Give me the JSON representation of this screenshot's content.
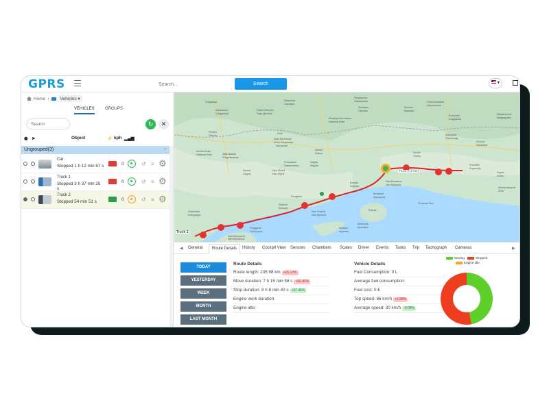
{
  "app": {
    "logo": "GPRS",
    "search_placeholder": "Search...",
    "search_button": "Search"
  },
  "breadcrumb": {
    "home": "Home",
    "vehicles": "Vehicles"
  },
  "left_tabs": {
    "vehicles": "VEHICLES",
    "groups": "GROUPS"
  },
  "left_search_placeholder": "Search",
  "table_head": {
    "object": "Object",
    "kph": "kph"
  },
  "group": {
    "label": "Ungrouped(3)",
    "collapse": "−"
  },
  "vehicles": [
    {
      "name": "Car",
      "status": "Stopped 1 h 12 min 57 s",
      "speed": "0",
      "engine_color": "#e53935",
      "signal_color": "#2eb85c"
    },
    {
      "name": "Truck 1",
      "status": "Stopped 3 h 37 min 25",
      "status2": "s",
      "speed": "0",
      "engine_color": "#e53935",
      "signal_color": "#2eb85c"
    },
    {
      "name": "Truck 2",
      "status": "Stopped 54 min 51 s",
      "speed": "0",
      "engine_color": "#2e9e44",
      "signal_color": "#f39c34"
    }
  ],
  "map": {
    "labels": [
      "Струмица",
      "Sandanski",
      "Сандански",
      "Gotse Delchev",
      "Гоце Делчев",
      "Satovcha",
      "Сатовча",
      "Pamporovo",
      "Пампорово",
      "Smolyan",
      "Смолян",
      "Rhodopi Mountains",
      "National Park",
      "Kirkovo",
      "Кирково",
      "Chernoochene",
      "Черноочене",
      "Kardzhali",
      "Кърджали",
      "Madzharovo",
      "Маджарово",
      "Petrich",
      "Петрич",
      "Kato Nevrokopi",
      "Κάτω Νευροκόπι",
      "Kerkini Lake",
      "National Park",
      "Sidirokastro",
      "Σιδηρόκαστρο",
      "Kato",
      "Nevrokopi",
      "Δράμα",
      "Drama",
      "Prosotsani",
      "Προσοτσάνη",
      "Xanthi",
      "Ξάνθη",
      "Komotini",
      "Κομοτηνή",
      "Sapes",
      "Σάπες",
      "Alexandroupoli",
      "Σπίτι",
      "Serres",
      "Σέρρες",
      "Nea Zichni",
      "Νέα Ζίχνη",
      "Nigrita",
      "Νιγρίτα",
      "Pangaion",
      "Kavala",
      "Καβάλα",
      "Nea Peramos",
      "Νέα Πέραμος",
      "Keramoti",
      "Κεραμωτή",
      "Limenaria",
      "Λιμενάρια",
      "Thasos",
      "Thracian Sea",
      "Nea Vrasna",
      "Νέα Βρασνα",
      "Stavros",
      "Σταυρός",
      "Kalamaria",
      "Καλαμαριά",
      "Ierissos",
      "Ιερισσός",
      "Polygyros",
      "Πολύγυρος",
      "Nea Moudania",
      "Νέα Μουδανιά",
      "Zlatograd",
      "Златоград",
      "Kirkovo",
      "Kardzhali",
      "Truck 2 (0 km)",
      "Truck 2"
    ],
    "truck_label": "Truck 2 (0 km)",
    "truck_label_left": "Truck 2"
  },
  "bottom_tabs": [
    "General",
    "Route Details",
    "History",
    "Cockpit View",
    "Sensors",
    "Chambers",
    "Scales",
    "Driver",
    "Events",
    "Tasks",
    "Trip",
    "Tachograph",
    "Cameras"
  ],
  "periods": [
    "TODAY",
    "YESTERDAY",
    "WEEK",
    "MONTH",
    "LAST MONTH"
  ],
  "route_details": {
    "title": "Route Details",
    "rows": [
      {
        "label": "Route length: 235.98 km",
        "badge": "+25.13%",
        "badge_type": "red"
      },
      {
        "label": "Move duration: 7 h 15 min 58 s",
        "badge": "+56.40%",
        "badge_type": "red"
      },
      {
        "label": "Stop duration: 8 h 8 min 40 s",
        "badge": "+97.46%",
        "badge_type": "green"
      },
      {
        "label": "Engine work duration:",
        "badge": "",
        "badge_type": ""
      },
      {
        "label": "Engine idle:",
        "badge": "",
        "badge_type": ""
      }
    ]
  },
  "vehicle_details": {
    "title": "Vehicle Details",
    "rows": [
      {
        "label": "Fuel Consumption: 0 L",
        "badge": "",
        "badge_type": ""
      },
      {
        "label": "Average fuel consumption:",
        "badge": "",
        "badge_type": ""
      },
      {
        "label": "Fuel cost: 0 €",
        "badge": "",
        "badge_type": ""
      },
      {
        "label": "Top speed: 86 km/h",
        "badge": "+2.38%",
        "badge_type": "red"
      },
      {
        "label": "Average speed: 30 km/h",
        "badge": "-9.09%",
        "badge_type": "green"
      }
    ]
  },
  "donut": {
    "legend": [
      {
        "name": "Moving",
        "color": "#5fcf2a"
      },
      {
        "name": "Stopped",
        "color": "#ee3e20"
      },
      {
        "name": "Engine idle",
        "color": "#f5a623"
      }
    ],
    "moving_fraction": 0.47,
    "stopped_fraction": 0.53
  },
  "colors": {
    "accent": "#1996e8",
    "route": "#d8262e"
  }
}
